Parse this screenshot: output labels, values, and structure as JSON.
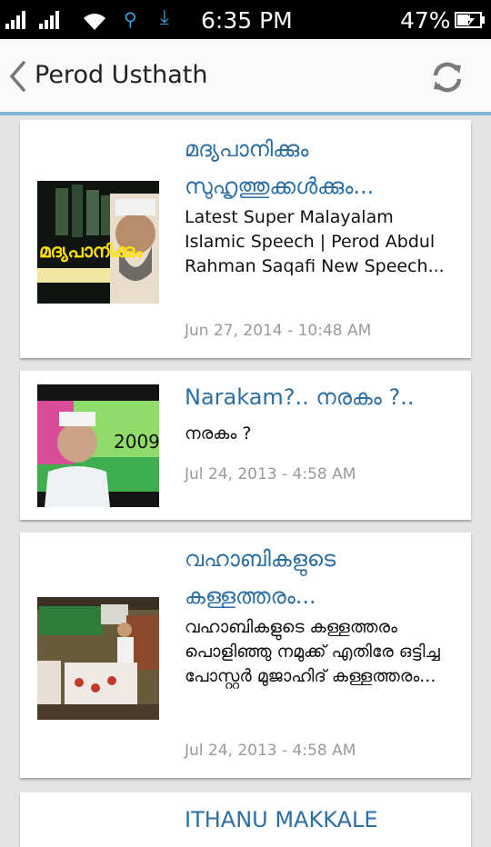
{
  "status_bar": {
    "time": "6:35 PM",
    "battery": "47%",
    "icons": [
      "signal-icon",
      "signal-icon",
      "wifi-icon",
      "usb-icon",
      "download-icon",
      "battery-charging-icon"
    ]
  },
  "action_bar": {
    "title": "Perod Usthath",
    "back_icon": "chevron-left-icon",
    "refresh_icon": "refresh-icon"
  },
  "colors": {
    "accent": "#7fb5d9",
    "title_link": "#2d6fa3",
    "date": "#9a9a9a",
    "background": "#e3e3e3"
  },
  "videos": [
    {
      "title": "മദ്യപാനിക്കും സുഹൃത്തുക്കൾക്കും...",
      "description": "Latest Super Malayalam Islamic Speech | Perod Abdul Rahman Saqafi New Speech...",
      "date": "Jun 27, 2014 - 10:48 AM",
      "thumb_text": "മദ്യപാനിക്കും"
    },
    {
      "title": "Narakam?.. നരകം ?..",
      "description": "നരകം ?",
      "date": "Jul 24, 2013 - 4:58 AM",
      "thumb_text": "2009"
    },
    {
      "title": "വഹാബികളുടെ കള്ളത്തരം...",
      "description": "വഹാബികളുടെ കള്ളത്തരം പൊളിഞ്ഞു നമുക്ക് എതിരേ ഒട്ടിച്ച പോസ്റ്റർ മുജാഹിദ് കള്ളത്തരം...",
      "date": "Jul 24, 2013 - 4:58 AM",
      "thumb_text": ""
    },
    {
      "title": "ITHANU MAKKALE",
      "description": "",
      "date": "",
      "thumb_text": ""
    }
  ]
}
